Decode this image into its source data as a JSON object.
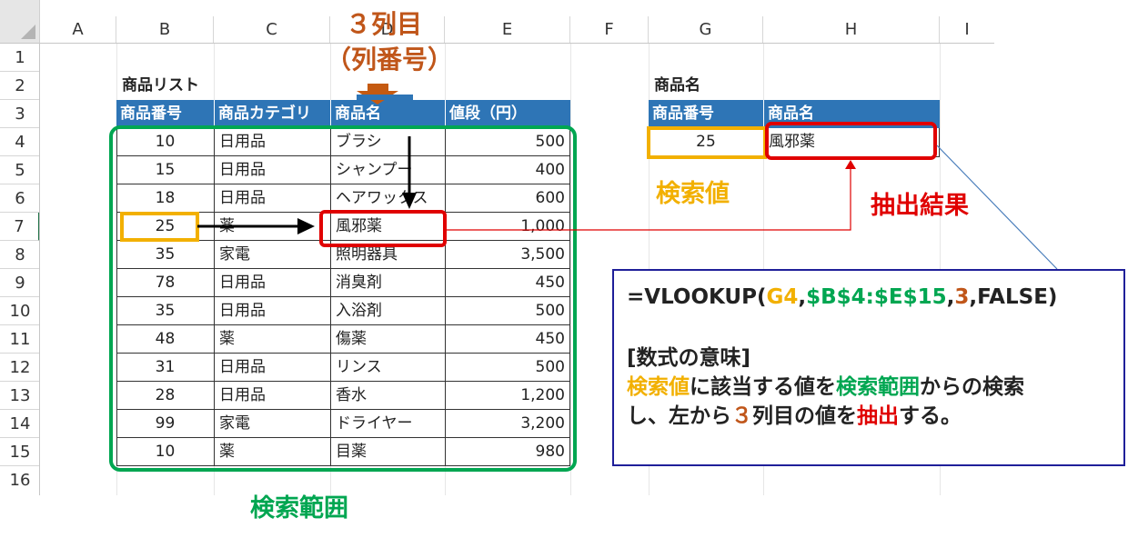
{
  "columns": [
    "A",
    "B",
    "C",
    "D",
    "E",
    "F",
    "G",
    "H",
    "I"
  ],
  "rows": [
    "1",
    "2",
    "3",
    "4",
    "5",
    "6",
    "7",
    "8",
    "9",
    "10",
    "11",
    "12",
    "13",
    "14",
    "15",
    "16"
  ],
  "table": {
    "title": "商品リスト",
    "headers": [
      "商品番号",
      "商品カテゴリ",
      "商品名",
      "値段（円）"
    ],
    "rows": [
      [
        "10",
        "日用品",
        "ブラシ",
        "500"
      ],
      [
        "15",
        "日用品",
        "シャンプー",
        "400"
      ],
      [
        "18",
        "日用品",
        "ヘアワックス",
        "600"
      ],
      [
        "25",
        "薬",
        "風邪薬",
        "1,000"
      ],
      [
        "35",
        "家電",
        "照明器具",
        "3,500"
      ],
      [
        "78",
        "日用品",
        "消臭剤",
        "450"
      ],
      [
        "35",
        "日用品",
        "入浴剤",
        "500"
      ],
      [
        "48",
        "薬",
        "傷薬",
        "450"
      ],
      [
        "31",
        "日用品",
        "リンス",
        "500"
      ],
      [
        "28",
        "日用品",
        "香水",
        "1,200"
      ],
      [
        "99",
        "家電",
        "ドライヤー",
        "3,200"
      ],
      [
        "10",
        "薬",
        "目薬",
        "980"
      ]
    ]
  },
  "lookup": {
    "title": "商品名",
    "headers": [
      "商品番号",
      "商品名"
    ],
    "values": [
      "25",
      "風邪薬"
    ]
  },
  "annotations": {
    "col_index_line1": "３列目",
    "col_index_line2": "（列番号）",
    "lookup_value": "検索値",
    "result": "抽出結果",
    "range": "検索範囲"
  },
  "formula": {
    "prefix": "=VLOOKUP(",
    "arg1": "G4",
    "comma1": ",",
    "arg2": "$B$4:$E$15",
    "comma2": ",",
    "arg3": "3",
    "rest": ",FALSE)",
    "meaning_title": "[数式の意味]",
    "line1_a": "検索値",
    "line1_b": "に該当する値を",
    "line1_c": "検索範囲",
    "line1_d": "からの検索",
    "line2_a": "し、左から",
    "line2_b": "３",
    "line2_c": "列目の値を",
    "line2_d": "抽出",
    "line2_e": "する。"
  },
  "colors": {
    "header_fill": "#2e75b6",
    "orange": "#f2b000",
    "green": "#00a651",
    "red": "#e00000",
    "brown": "#c0561a",
    "navy": "#1f1f99"
  }
}
